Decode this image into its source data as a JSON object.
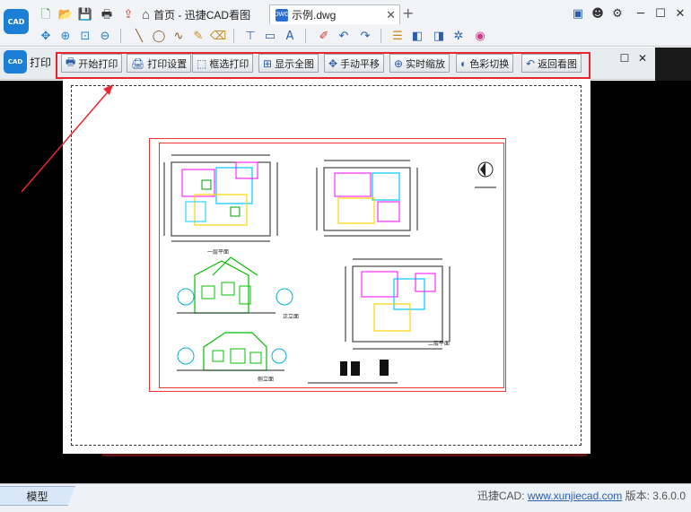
{
  "tabs": {
    "home_label": "首页 - 迅捷CAD看图",
    "file_label": "示例.dwg",
    "file_icon_text": "DWG"
  },
  "app_logo_text": "CAD",
  "print_bar": {
    "title": "打印",
    "buttons": [
      {
        "label": "开始打印",
        "icon": "printer-icon"
      },
      {
        "label": "打印设置",
        "icon": "print-settings-icon"
      },
      {
        "label": "框选打印",
        "icon": "select-frame-icon"
      },
      {
        "label": "显示全图",
        "icon": "zoom-extents-icon"
      },
      {
        "label": "手动平移",
        "icon": "pan-icon"
      },
      {
        "label": "实时缩放",
        "icon": "realtime-zoom-icon"
      },
      {
        "label": "色彩切换",
        "icon": "color-switch-icon"
      },
      {
        "label": "返回看图",
        "icon": "back-icon"
      }
    ]
  },
  "drawing_labels": {
    "plan1": "一层平面",
    "plan2": "二层平面",
    "elev1": "正立面",
    "elev2": "侧立面"
  },
  "status": {
    "model_tab": "模型",
    "brand": "迅捷CAD:",
    "url": "www.xunjiecad.com",
    "version_label": "版本: 3.6.0.0"
  },
  "colors": {
    "accent_blue": "#1c7fd6",
    "highlight_red": "#e8262e",
    "canvas_bg": "#000000"
  }
}
